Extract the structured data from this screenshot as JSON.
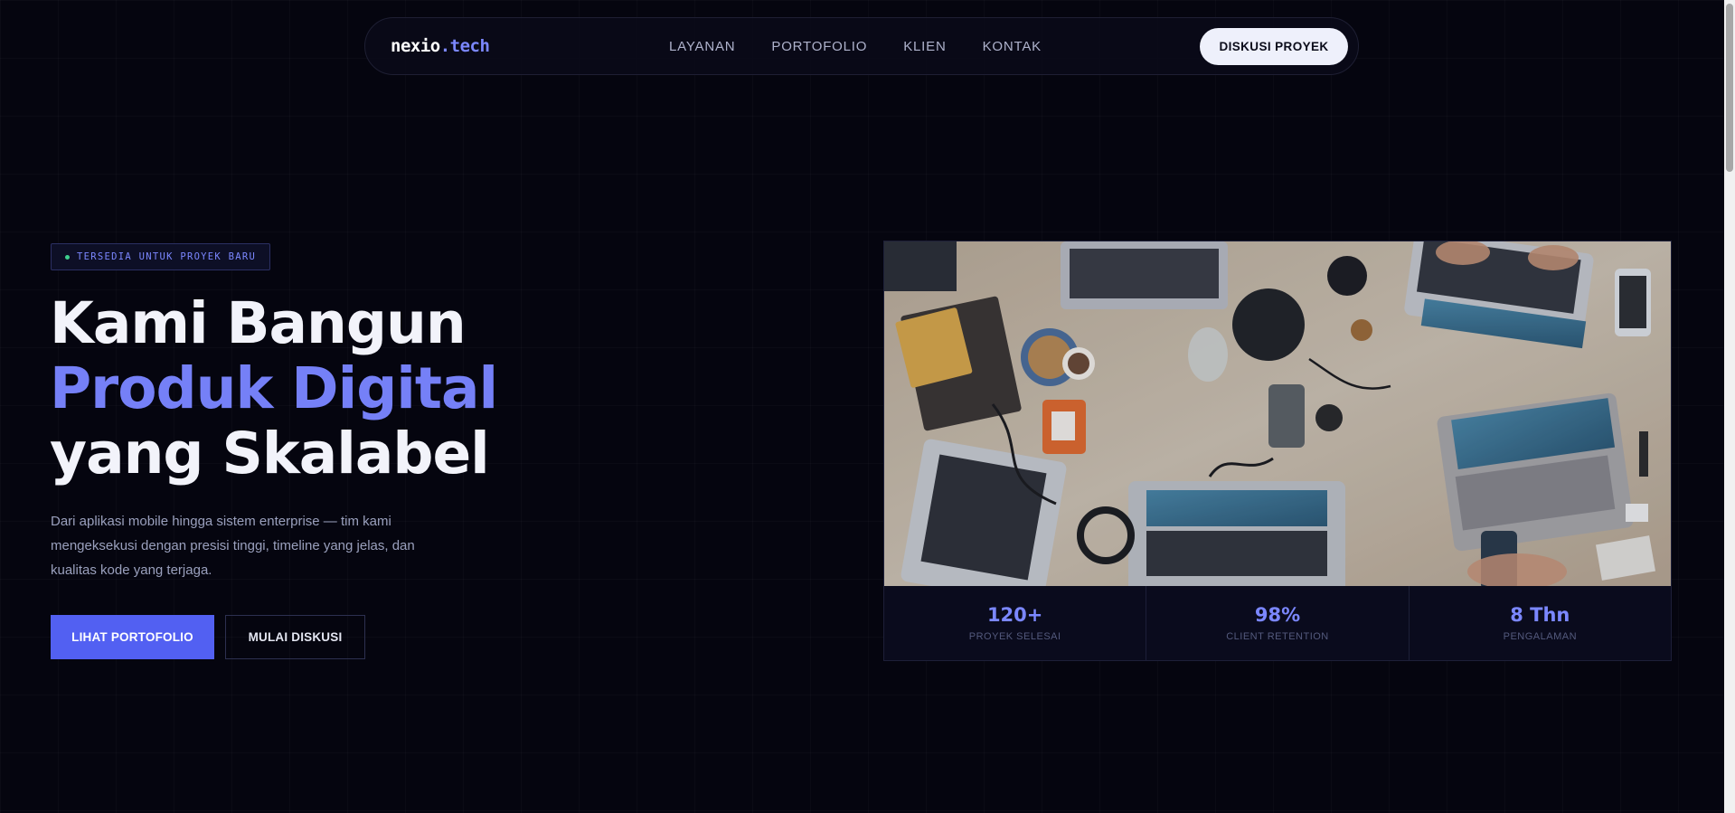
{
  "nav": {
    "logo_main": "nexio",
    "logo_accent": ".tech",
    "links": [
      "LAYANAN",
      "PORTOFOLIO",
      "KLIEN",
      "KONTAK"
    ],
    "cta": "DISKUSI PROYEK"
  },
  "hero": {
    "badge": "TERSEDIA UNTUK PROYEK BARU",
    "headline": [
      "Kami Bangun",
      "Produk Digital",
      "yang Skalabel"
    ],
    "subtext": "Dari aplikasi mobile hingga sistem enterprise — tim kami mengeksekusi dengan presisi tinggi, timeline yang jelas, dan kualitas kode yang terjaga.",
    "primary_button": "LIHAT PORTOFOLIO",
    "secondary_button": "MULAI DISKUSI"
  },
  "stats": [
    {
      "value": "120+",
      "label": "PROYEK SELESAI"
    },
    {
      "value": "98%",
      "label": "CLIENT RETENTION"
    },
    {
      "value": "8 Thn",
      "label": "PENGALAMAN"
    }
  ],
  "colors": {
    "background": "#05050f",
    "accent": "#7b87ff",
    "primary_button": "#5260f2",
    "status_dot": "#3ecf8e"
  }
}
